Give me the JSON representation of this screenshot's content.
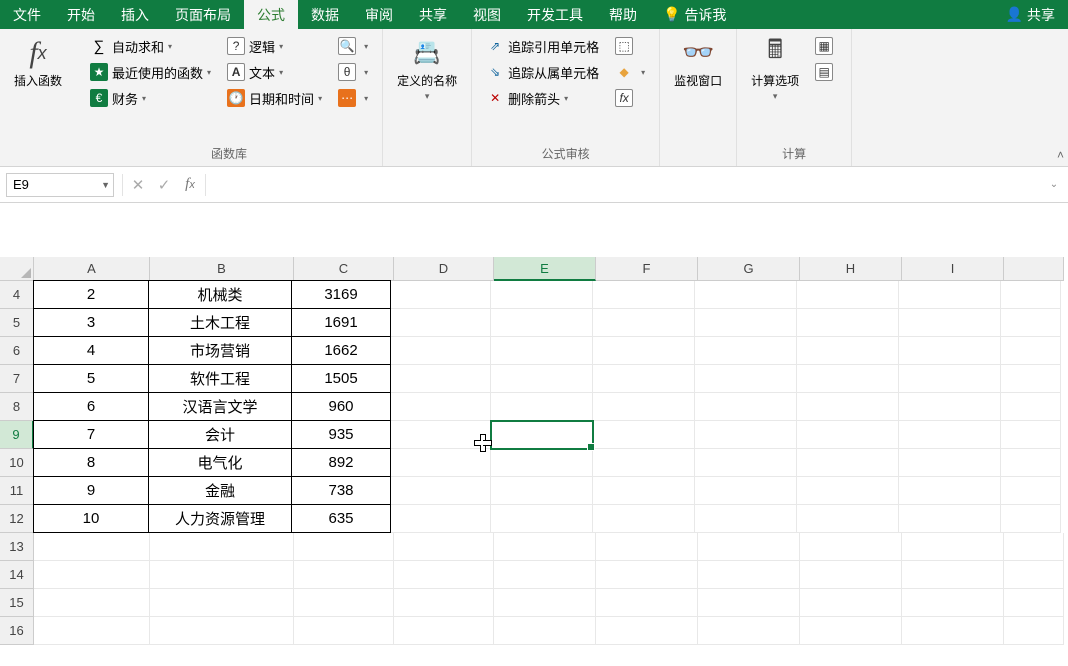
{
  "menu": {
    "items": [
      "文件",
      "开始",
      "插入",
      "页面布局",
      "公式",
      "数据",
      "审阅",
      "共享",
      "视图",
      "开发工具",
      "帮助"
    ],
    "active_index": 4,
    "tell_me": "告诉我",
    "share": "共享"
  },
  "ribbon": {
    "insert_function": "插入函数",
    "function_library": {
      "label": "函数库",
      "autosum": "自动求和",
      "recent": "最近使用的函数",
      "financial": "财务",
      "logical": "逻辑",
      "text": "文本",
      "datetime": "日期和时间"
    },
    "defined_names": {
      "label": "定义的名称"
    },
    "formula_audit": {
      "label": "公式审核",
      "trace_precedents": "追踪引用单元格",
      "trace_dependents": "追踪从属单元格",
      "remove_arrows": "删除箭头"
    },
    "watch_window": "监视窗口",
    "calculation": {
      "label": "计算",
      "options": "计算选项"
    }
  },
  "namebox": "E9",
  "formula_value": "",
  "columns": [
    "A",
    "B",
    "C",
    "D",
    "E",
    "F",
    "G",
    "H",
    "I"
  ],
  "selected_col_index": 4,
  "rows": [
    4,
    5,
    6,
    7,
    8,
    9,
    10,
    11,
    12,
    13,
    14,
    15,
    16
  ],
  "selected_row": 9,
  "table": [
    {
      "a": "2",
      "b": "机械类",
      "c": "3169"
    },
    {
      "a": "3",
      "b": "土木工程",
      "c": "1691"
    },
    {
      "a": "4",
      "b": "市场营销",
      "c": "1662"
    },
    {
      "a": "5",
      "b": "软件工程",
      "c": "1505"
    },
    {
      "a": "6",
      "b": "汉语言文学",
      "c": "960"
    },
    {
      "a": "7",
      "b": "会计",
      "c": "935"
    },
    {
      "a": "8",
      "b": "电气化",
      "c": "892"
    },
    {
      "a": "9",
      "b": "金融",
      "c": "738"
    },
    {
      "a": "10",
      "b": "人力资源管理",
      "c": "635"
    }
  ]
}
